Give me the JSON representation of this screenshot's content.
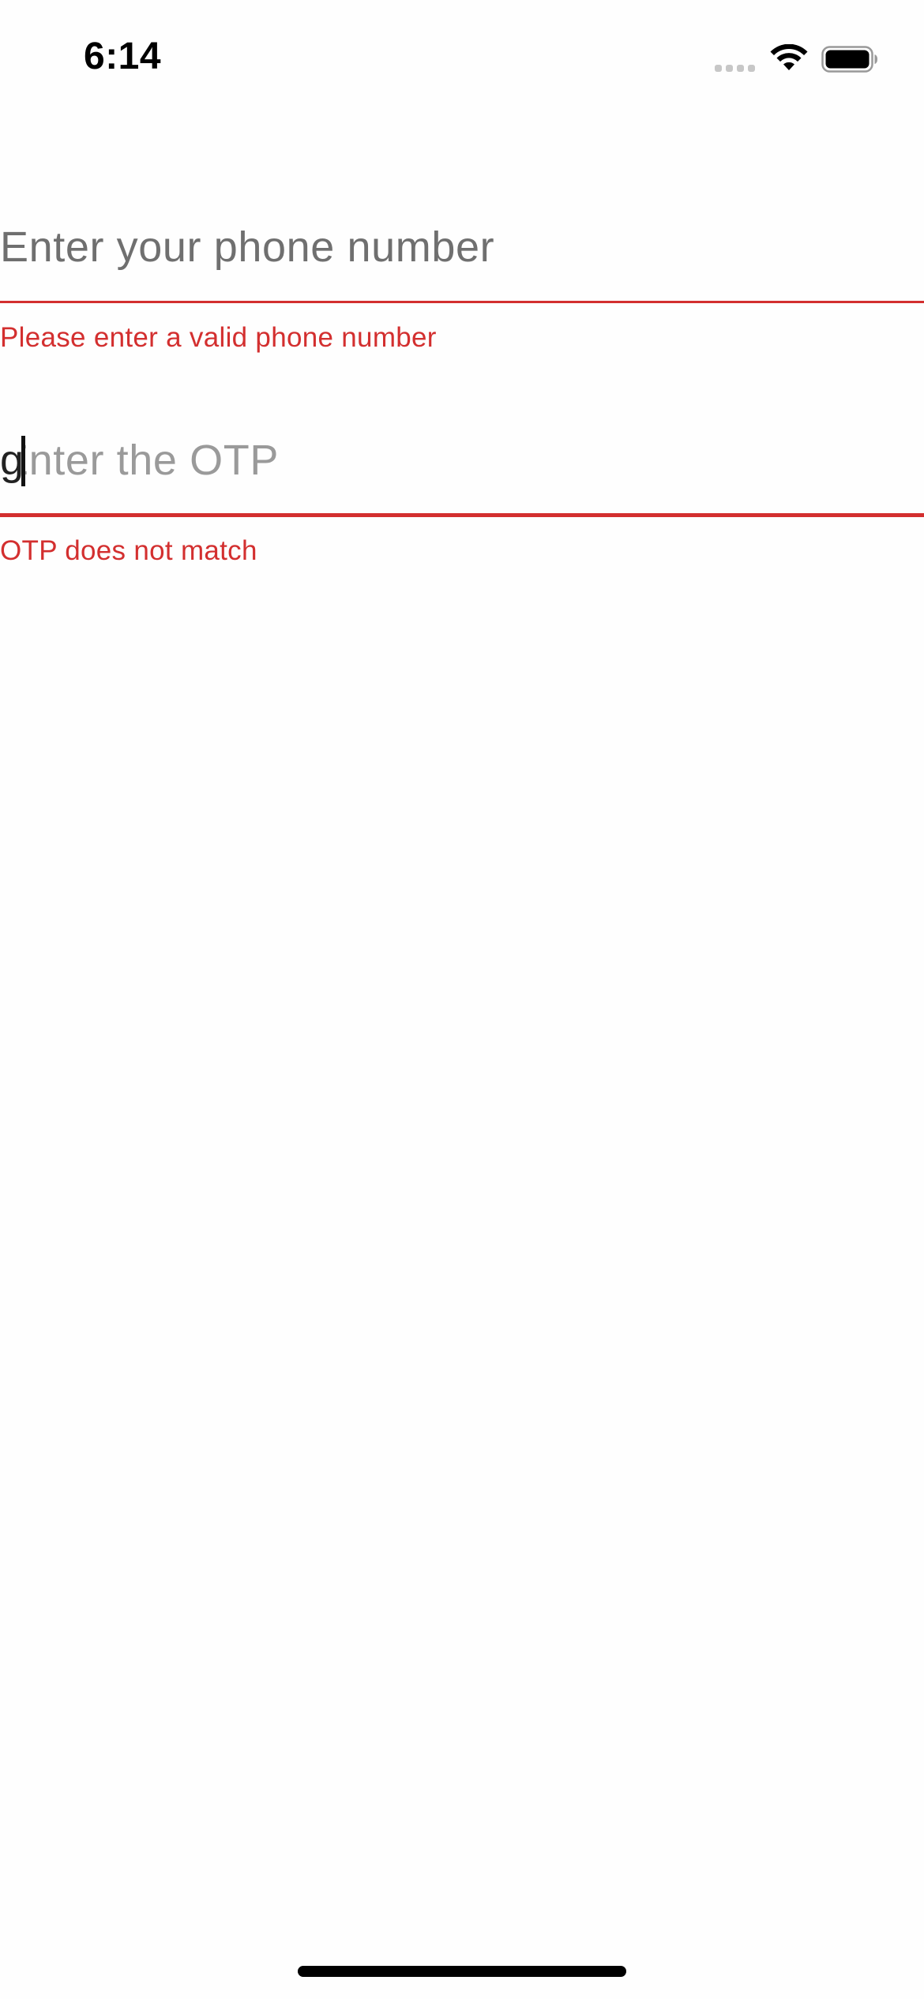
{
  "status_bar": {
    "time": "6:14",
    "icons": [
      "cellular-signal-icon",
      "wifi-icon",
      "battery-icon"
    ]
  },
  "form": {
    "phone": {
      "placeholder": "Enter your phone number",
      "value": "",
      "error": "Please enter a valid phone number"
    },
    "otp": {
      "placeholder": "Enter the OTP",
      "value": "g",
      "error": "OTP does not match"
    }
  },
  "colors": {
    "error": "#d32f2f",
    "placeholder": "#6f6f6f",
    "background": "#fefefe"
  }
}
